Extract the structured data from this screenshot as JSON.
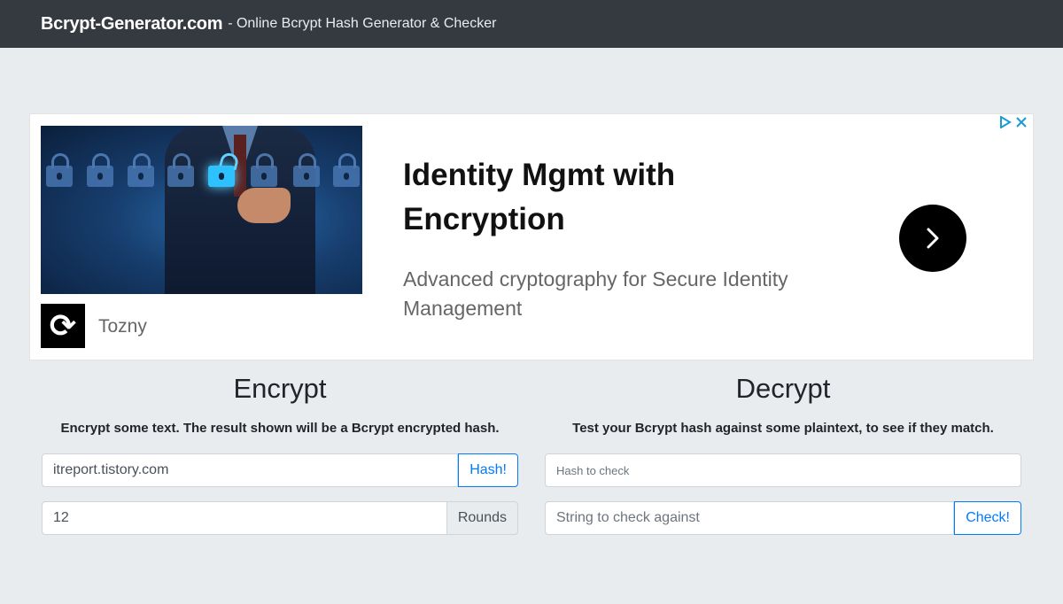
{
  "navbar": {
    "brand": "Bcrypt-Generator.com",
    "tagline": "- Online Bcrypt Hash Generator & Checker"
  },
  "ad": {
    "headline": "Identity Mgmt with Encryption",
    "description": "Advanced cryptography for Secure Identity Management",
    "advertiser": "Tozny"
  },
  "encrypt": {
    "title": "Encrypt",
    "subtitle": "Encrypt some text. The result shown will be a Bcrypt encrypted hash.",
    "text_value": "itreport.tistory.com",
    "hash_button": "Hash!",
    "rounds_value": "12",
    "rounds_label": "Rounds"
  },
  "decrypt": {
    "title": "Decrypt",
    "subtitle": "Test your Bcrypt hash against some plaintext, to see if they match.",
    "hash_placeholder": "Hash to check",
    "string_placeholder": "String to check against",
    "check_button": "Check!"
  }
}
